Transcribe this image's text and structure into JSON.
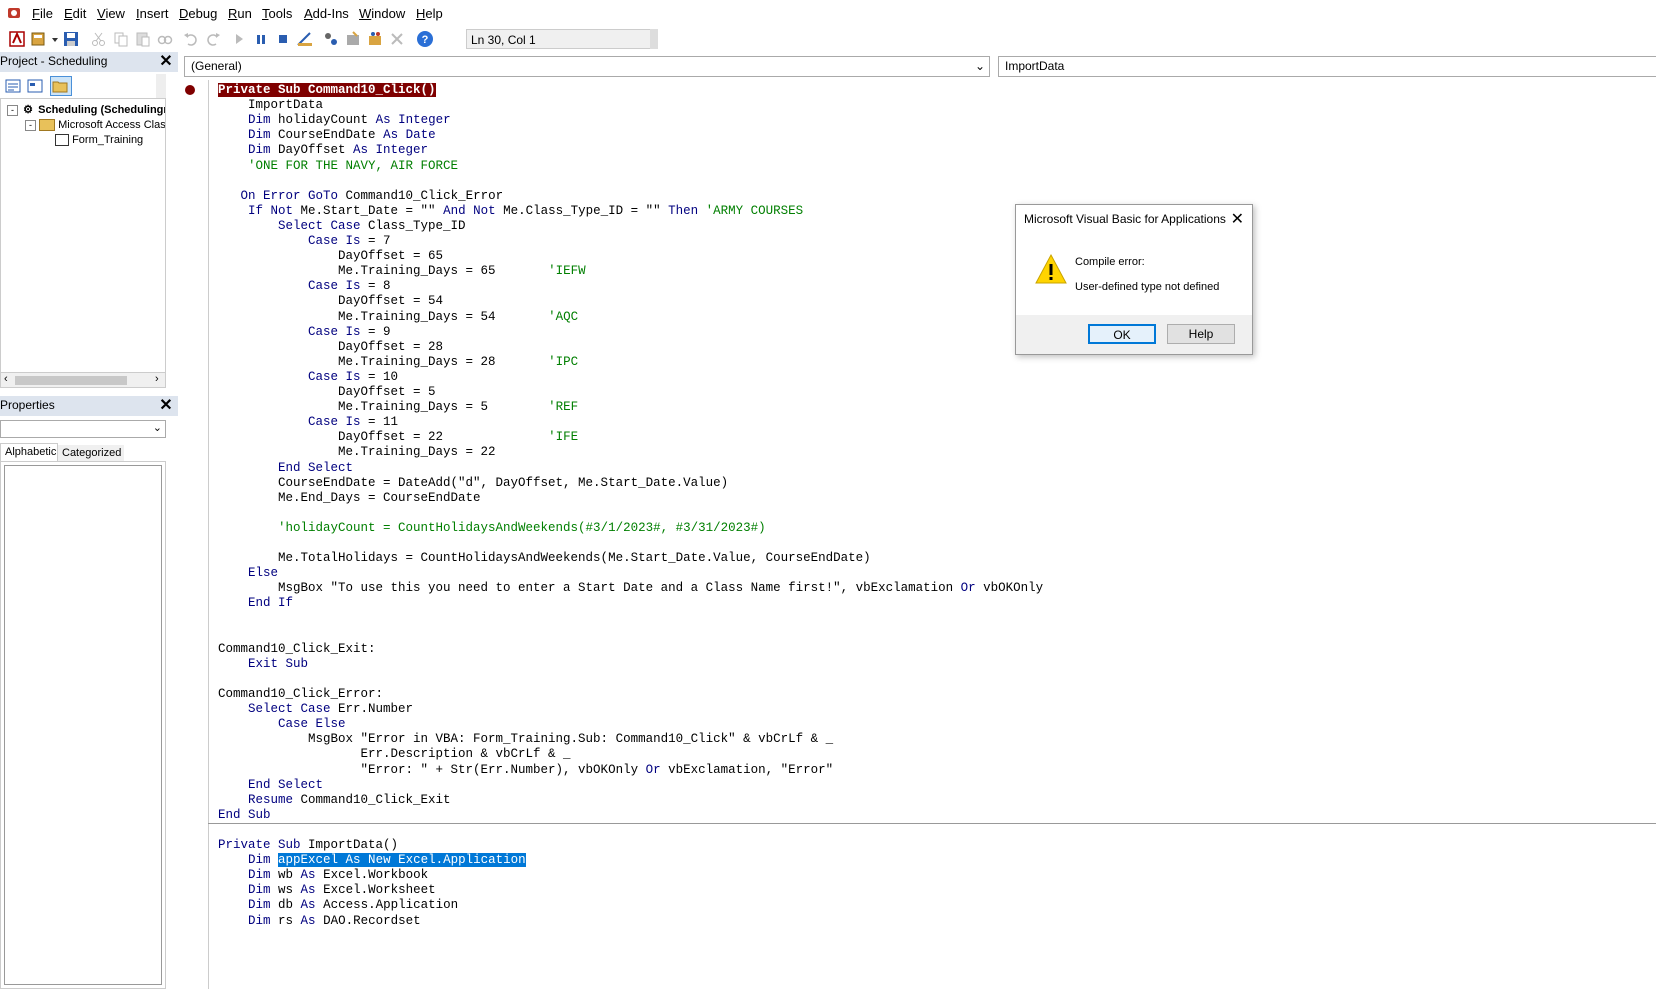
{
  "menubar": {
    "items": [
      {
        "label": "File",
        "u": "F"
      },
      {
        "label": "Edit",
        "u": "E"
      },
      {
        "label": "View",
        "u": "V"
      },
      {
        "label": "Insert",
        "u": "I"
      },
      {
        "label": "Debug",
        "u": "D"
      },
      {
        "label": "Run",
        "u": "R"
      },
      {
        "label": "Tools",
        "u": "T"
      },
      {
        "label": "Add-Ins",
        "u": "A"
      },
      {
        "label": "Window",
        "u": "W"
      },
      {
        "label": "Help",
        "u": "H"
      }
    ]
  },
  "toolbar": {
    "position": "Ln 30, Col 1"
  },
  "project": {
    "title": "Project - Scheduling",
    "tree": {
      "root": "Scheduling (Schedulingr",
      "folder": "Microsoft Access Class O",
      "item": "Form_Training"
    }
  },
  "properties": {
    "title": "Properties",
    "tabs": [
      "Alphabetic",
      "Categorized"
    ]
  },
  "editor": {
    "object_combo": "(General)",
    "proc_combo": "ImportData",
    "lines": [
      [
        {
          "t": "Private Sub Command10_Click()",
          "c": "bp"
        }
      ],
      [
        {
          "t": "    ImportData"
        }
      ],
      [
        {
          "t": "    "
        },
        {
          "t": "Dim",
          "c": "kw"
        },
        {
          "t": " holidayCount "
        },
        {
          "t": "As Integer",
          "c": "kw"
        }
      ],
      [
        {
          "t": "    "
        },
        {
          "t": "Dim",
          "c": "kw"
        },
        {
          "t": " CourseEndDate "
        },
        {
          "t": "As Date",
          "c": "kw"
        }
      ],
      [
        {
          "t": "    "
        },
        {
          "t": "Dim",
          "c": "kw"
        },
        {
          "t": " DayOffset "
        },
        {
          "t": "As Integer",
          "c": "kw"
        }
      ],
      [
        {
          "t": "    'ONE FOR THE NAVY, AIR FORCE",
          "c": "cm"
        }
      ],
      [
        {
          "t": ""
        }
      ],
      [
        {
          "t": "   "
        },
        {
          "t": "On Error GoTo",
          "c": "kw"
        },
        {
          "t": " Command10_Click_Error"
        }
      ],
      [
        {
          "t": "    "
        },
        {
          "t": "If Not",
          "c": "kw"
        },
        {
          "t": " Me.Start_Date = \"\" "
        },
        {
          "t": "And Not",
          "c": "kw"
        },
        {
          "t": " Me.Class_Type_ID = \"\" "
        },
        {
          "t": "Then",
          "c": "kw"
        },
        {
          "t": " 'ARMY COURSES",
          "c": "cm"
        }
      ],
      [
        {
          "t": "        "
        },
        {
          "t": "Select Case",
          "c": "kw"
        },
        {
          "t": " Class_Type_ID"
        }
      ],
      [
        {
          "t": "            "
        },
        {
          "t": "Case Is",
          "c": "kw"
        },
        {
          "t": " = 7"
        }
      ],
      [
        {
          "t": "                DayOffset = 65"
        }
      ],
      [
        {
          "t": "                Me.Training_Days = 65       "
        },
        {
          "t": "'IEFW",
          "c": "cm"
        }
      ],
      [
        {
          "t": "            "
        },
        {
          "t": "Case Is",
          "c": "kw"
        },
        {
          "t": " = 8"
        }
      ],
      [
        {
          "t": "                DayOffset = 54"
        }
      ],
      [
        {
          "t": "                Me.Training_Days = 54       "
        },
        {
          "t": "'AQC",
          "c": "cm"
        }
      ],
      [
        {
          "t": "            "
        },
        {
          "t": "Case Is",
          "c": "kw"
        },
        {
          "t": " = 9"
        }
      ],
      [
        {
          "t": "                DayOffset = 28"
        }
      ],
      [
        {
          "t": "                Me.Training_Days = 28       "
        },
        {
          "t": "'IPC",
          "c": "cm"
        }
      ],
      [
        {
          "t": "            "
        },
        {
          "t": "Case Is",
          "c": "kw"
        },
        {
          "t": " = 10"
        }
      ],
      [
        {
          "t": "                DayOffset = 5"
        }
      ],
      [
        {
          "t": "                Me.Training_Days = 5        "
        },
        {
          "t": "'REF",
          "c": "cm"
        }
      ],
      [
        {
          "t": "            "
        },
        {
          "t": "Case Is",
          "c": "kw"
        },
        {
          "t": " = 11"
        }
      ],
      [
        {
          "t": "                DayOffset = 22              "
        },
        {
          "t": "'IFE",
          "c": "cm"
        }
      ],
      [
        {
          "t": "                Me.Training_Days = 22"
        }
      ],
      [
        {
          "t": "        "
        },
        {
          "t": "End Select",
          "c": "kw"
        }
      ],
      [
        {
          "t": "        CourseEndDate = DateAdd(\"d\", DayOffset, Me.Start_Date.Value)"
        }
      ],
      [
        {
          "t": "        Me.End_Days = CourseEndDate"
        }
      ],
      [
        {
          "t": ""
        }
      ],
      [
        {
          "t": "        'holidayCount = CountHolidaysAndWeekends(#3/1/2023#, #3/31/2023#)",
          "c": "cm"
        }
      ],
      [
        {
          "t": ""
        }
      ],
      [
        {
          "t": "        Me.TotalHolidays = CountHolidaysAndWeekends(Me.Start_Date.Value, CourseEndDate)"
        }
      ],
      [
        {
          "t": "    "
        },
        {
          "t": "Else",
          "c": "kw"
        }
      ],
      [
        {
          "t": "        MsgBox \"To use this you need to enter a Start Date and a Class Name first!\", vbExclamation "
        },
        {
          "t": "Or",
          "c": "kw"
        },
        {
          "t": " vbOKOnly"
        }
      ],
      [
        {
          "t": "    "
        },
        {
          "t": "End If",
          "c": "kw"
        }
      ],
      [
        {
          "t": ""
        }
      ],
      [
        {
          "t": ""
        }
      ],
      [
        {
          "t": "Command10_Click_Exit:"
        }
      ],
      [
        {
          "t": "    "
        },
        {
          "t": "Exit Sub",
          "c": "kw"
        }
      ],
      [
        {
          "t": ""
        }
      ],
      [
        {
          "t": "Command10_Click_Error:"
        }
      ],
      [
        {
          "t": "    "
        },
        {
          "t": "Select Case",
          "c": "kw"
        },
        {
          "t": " Err.Number"
        }
      ],
      [
        {
          "t": "        "
        },
        {
          "t": "Case Else",
          "c": "kw"
        }
      ],
      [
        {
          "t": "            MsgBox \"Error in VBA: Form_Training.Sub: Command10_Click\" & vbCrLf & _"
        }
      ],
      [
        {
          "t": "                   Err.Description & vbCrLf & _"
        }
      ],
      [
        {
          "t": "                   \"Error: \" + Str(Err.Number), vbOKOnly "
        },
        {
          "t": "Or",
          "c": "kw"
        },
        {
          "t": " vbExclamation, \"Error\""
        }
      ],
      [
        {
          "t": "    "
        },
        {
          "t": "End Select",
          "c": "kw"
        }
      ],
      [
        {
          "t": "    "
        },
        {
          "t": "Resume",
          "c": "kw"
        },
        {
          "t": " Command10_Click_Exit"
        }
      ],
      [
        {
          "t": "End Sub",
          "c": "kw"
        }
      ],
      [
        {
          "t": ""
        }
      ],
      [
        {
          "t": "Private Sub",
          "c": "kw"
        },
        {
          "t": " ImportData()"
        }
      ],
      [
        {
          "t": "    "
        },
        {
          "t": "Dim",
          "c": "kw"
        },
        {
          "t": " "
        },
        {
          "t": "appExcel As New Excel.Application",
          "c": "sel"
        }
      ],
      [
        {
          "t": "    "
        },
        {
          "t": "Dim",
          "c": "kw"
        },
        {
          "t": " wb "
        },
        {
          "t": "As",
          "c": "kw"
        },
        {
          "t": " Excel.Workbook"
        }
      ],
      [
        {
          "t": "    "
        },
        {
          "t": "Dim",
          "c": "kw"
        },
        {
          "t": " ws "
        },
        {
          "t": "As",
          "c": "kw"
        },
        {
          "t": " Excel.Worksheet"
        }
      ],
      [
        {
          "t": "    "
        },
        {
          "t": "Dim",
          "c": "kw"
        },
        {
          "t": " db "
        },
        {
          "t": "As",
          "c": "kw"
        },
        {
          "t": " Access.Application"
        }
      ],
      [
        {
          "t": "    "
        },
        {
          "t": "Dim",
          "c": "kw"
        },
        {
          "t": " rs "
        },
        {
          "t": "As",
          "c": "kw"
        },
        {
          "t": " DAO.Recordset"
        }
      ]
    ]
  },
  "dialog": {
    "title": "Microsoft Visual Basic for Applications",
    "heading": "Compile error:",
    "message": "User-defined type not defined",
    "ok_label": "OK",
    "help_label": "Help"
  },
  "colors": {
    "keyword": "#00007f",
    "comment": "#007f00",
    "breakpoint": "#7f0000",
    "selection": "#0078d7"
  }
}
